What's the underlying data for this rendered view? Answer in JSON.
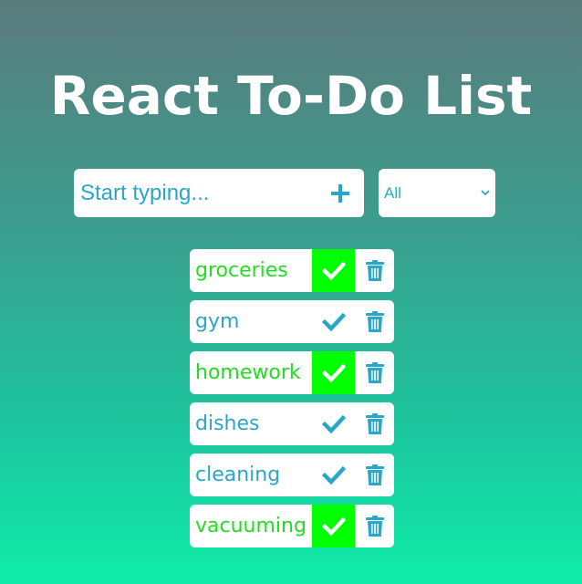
{
  "header": {
    "title": "React To-Do List"
  },
  "form": {
    "input_placeholder": "Start typing...",
    "input_value": "",
    "add_icon": "plus-icon",
    "filter_selected": "All",
    "filter_icon": "chevron-down-icon"
  },
  "colors": {
    "accent": "#2aa6c8",
    "completed_text": "#22dd22",
    "completed_button": "#00ff00",
    "background_top": "#5b7a7c",
    "background_bottom": "#10eda8"
  },
  "todos": [
    {
      "text": "groceries",
      "completed": true
    },
    {
      "text": "gym",
      "completed": false
    },
    {
      "text": "homework",
      "completed": true
    },
    {
      "text": "dishes",
      "completed": false
    },
    {
      "text": "cleaning",
      "completed": false
    },
    {
      "text": "vacuuming",
      "completed": true
    }
  ],
  "icons": {
    "complete": "check-icon",
    "delete": "trash-icon"
  }
}
